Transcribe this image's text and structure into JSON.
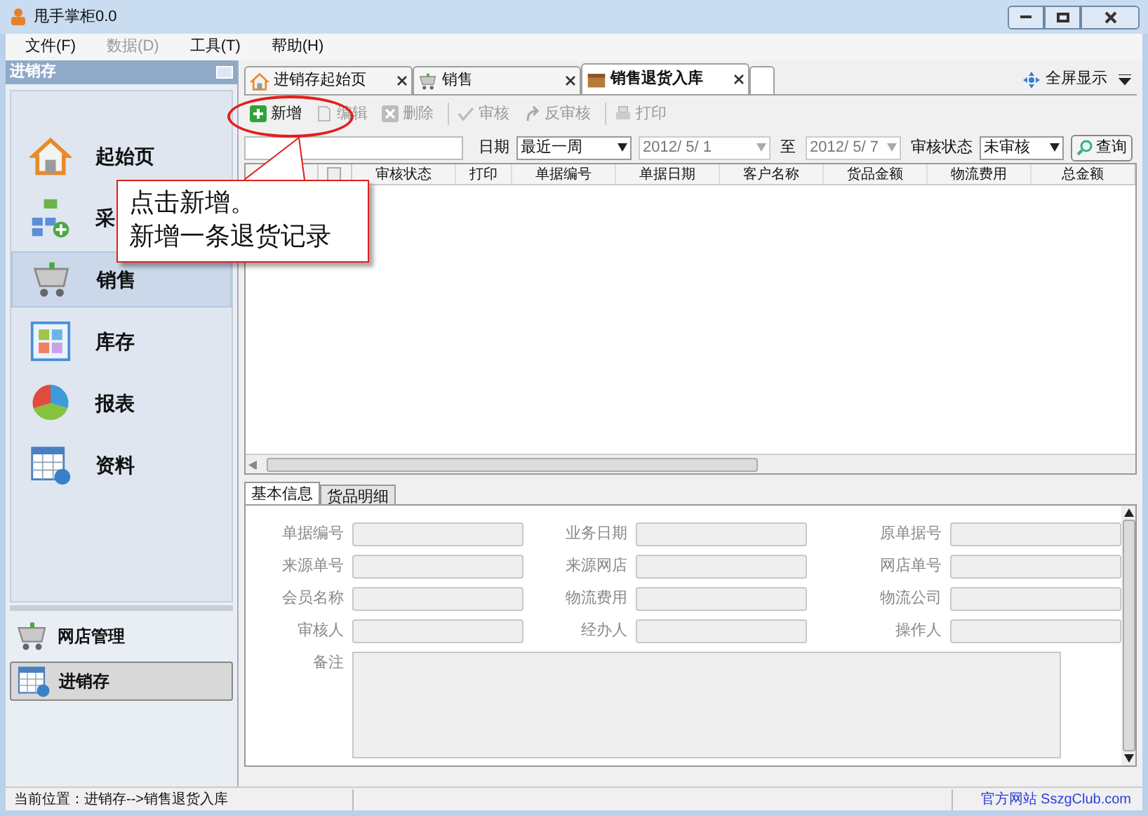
{
  "window": {
    "title": "甩手掌柜0.0"
  },
  "menu": [
    {
      "label": "文件(F)",
      "disabled": false
    },
    {
      "label": "数据(D)",
      "disabled": true
    },
    {
      "label": "工具(T)",
      "disabled": false
    },
    {
      "label": "帮助(H)",
      "disabled": false
    }
  ],
  "sidebar": {
    "title": "进销存",
    "items": [
      {
        "label": "起始页",
        "selected": false
      },
      {
        "label": "采",
        "selected": false
      },
      {
        "label": "销售",
        "selected": true
      },
      {
        "label": "库存",
        "selected": false
      },
      {
        "label": "报表",
        "selected": false
      },
      {
        "label": "资料",
        "selected": false
      }
    ],
    "bottom_items": [
      {
        "label": "网店管理",
        "selected": false
      },
      {
        "label": "进销存",
        "selected": true
      }
    ]
  },
  "tabs": [
    {
      "label": "进销存起始页",
      "selected": false
    },
    {
      "label": "销售",
      "selected": false
    },
    {
      "label": "销售退货入库",
      "selected": true
    }
  ],
  "fullscreen": "全屏显示",
  "toolbar": [
    {
      "label": "新增",
      "disabled": false
    },
    {
      "label": "编辑",
      "disabled": true
    },
    {
      "label": "删除",
      "disabled": true
    },
    {
      "label": "审核",
      "disabled": true
    },
    {
      "label": "反审核",
      "disabled": true
    },
    {
      "label": "打印",
      "disabled": true
    }
  ],
  "filter": {
    "date_label": "日期",
    "range": "最近一周",
    "from": "2012/ 5/ 1",
    "to_label": "至",
    "to": "2012/ 5/ 7",
    "status_label": "审核状态",
    "status": "未审核",
    "query": "查询"
  },
  "table": {
    "header_checkbox": {
      "checked": false
    },
    "columns": [
      "审核状态",
      "打印",
      "单据编号",
      "单据日期",
      "客户名称",
      "货品金额",
      "物流费用",
      "总金额"
    ]
  },
  "detail_tabs": [
    {
      "label": "基本信息",
      "selected": true
    },
    {
      "label": "货品明细",
      "selected": false
    }
  ],
  "form": {
    "fields": [
      {
        "label": "单据编号"
      },
      {
        "label": "业务日期"
      },
      {
        "label": "原单据号"
      },
      {
        "label": "来源单号"
      },
      {
        "label": "来源网店"
      },
      {
        "label": "网店单号"
      },
      {
        "label": "会员名称"
      },
      {
        "label": "物流费用"
      },
      {
        "label": "物流公司"
      },
      {
        "label": "审核人"
      },
      {
        "label": "经办人"
      },
      {
        "label": "操作人"
      }
    ],
    "remark_label": "备注"
  },
  "callout": {
    "lines": [
      "点击新增。",
      "新增一条退货记录"
    ]
  },
  "status_bar": {
    "location": "当前位置：进销存-->销售退货入库",
    "link": "官方网站 SszgClub.com"
  }
}
